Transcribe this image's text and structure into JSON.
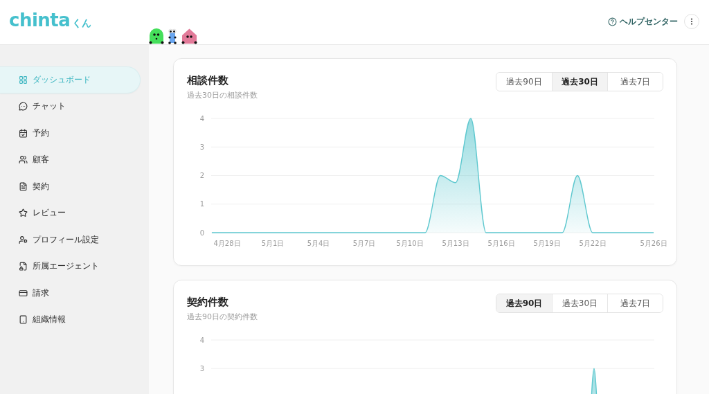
{
  "header": {
    "logo": {
      "wordmark": "chinta",
      "suffix": "くん"
    },
    "help_link": "ヘルプセンター"
  },
  "sidebar": {
    "items": [
      {
        "label": "ダッシュボード",
        "selected": true
      },
      {
        "label": "チャット",
        "selected": false
      },
      {
        "label": "予約",
        "selected": false
      },
      {
        "label": "顧客",
        "selected": false
      },
      {
        "label": "契約",
        "selected": false
      },
      {
        "label": "レビュー",
        "selected": false
      },
      {
        "label": "プロフィール設定",
        "selected": false
      },
      {
        "label": "所属エージェント",
        "selected": false
      },
      {
        "label": "請求",
        "selected": false
      },
      {
        "label": "組織情報",
        "selected": false
      }
    ]
  },
  "cards": [
    {
      "title": "相談件数",
      "subtitle": "過去30日の相談件数",
      "ranges": [
        {
          "label": "過去90日",
          "selected": false
        },
        {
          "label": "過去30日",
          "selected": true
        },
        {
          "label": "過去7日",
          "selected": false
        }
      ],
      "chart_data": {
        "type": "area",
        "grid": true,
        "categories": [
          null,
          "4月28日",
          null,
          null,
          "5月1日",
          null,
          null,
          "5月4日",
          null,
          null,
          "5月7日",
          null,
          null,
          "5月10日",
          null,
          null,
          "5月13日",
          null,
          null,
          "5月16日",
          null,
          null,
          "5月19日",
          null,
          null,
          "5月22日",
          null,
          null,
          null,
          "5月26日"
        ],
        "ylim": [
          0,
          4
        ],
        "yticks": [
          0,
          1,
          2,
          3,
          4
        ],
        "series": [
          {
            "color": "#5ec8cf",
            "values": [
              0,
              0,
              0,
              0,
              0,
              0,
              0,
              0,
              0,
              0,
              0,
              0,
              0,
              0,
              0,
              2,
              1.75,
              4,
              0,
              0,
              0,
              0,
              0,
              0,
              2,
              0,
              0,
              0,
              0,
              0
            ]
          }
        ]
      }
    },
    {
      "title": "契約件数",
      "subtitle": "過去90日の契約件数",
      "ranges": [
        {
          "label": "過去90日",
          "selected": true
        },
        {
          "label": "過去30日",
          "selected": false
        },
        {
          "label": "過去7日",
          "selected": false
        }
      ],
      "chart_data": {
        "type": "area",
        "grid": true,
        "categories": [
          null,
          null,
          null,
          null,
          null,
          null,
          null,
          null,
          null,
          null,
          null,
          null,
          null,
          null,
          null,
          null,
          null,
          null,
          null,
          null,
          null,
          null,
          null,
          null,
          null,
          null,
          null,
          null,
          null,
          null,
          null,
          null,
          null,
          null,
          null,
          null,
          null,
          null,
          null,
          null,
          null,
          null,
          null,
          null,
          null,
          null,
          null,
          null,
          null,
          null,
          null,
          null,
          null,
          null,
          null,
          null,
          null,
          null,
          null,
          null,
          null,
          null,
          null,
          null,
          null,
          null,
          null,
          null,
          null,
          null,
          null,
          null,
          null,
          null,
          null,
          null,
          null,
          null,
          null,
          null,
          null,
          null,
          null,
          null,
          null,
          null,
          null,
          null,
          null,
          null
        ],
        "ylim": [
          0,
          4
        ],
        "yticks": [
          3,
          4
        ],
        "series": [
          {
            "color": "#5ec8cf",
            "values": [
              null,
              null,
              null,
              null,
              null,
              null,
              null,
              null,
              null,
              null,
              null,
              null,
              null,
              null,
              null,
              null,
              null,
              null,
              null,
              null,
              null,
              null,
              null,
              null,
              null,
              null,
              null,
              null,
              null,
              null,
              null,
              null,
              null,
              null,
              null,
              null,
              null,
              null,
              null,
              null,
              null,
              null,
              null,
              null,
              null,
              null,
              null,
              null,
              null,
              null,
              null,
              null,
              null,
              null,
              null,
              null,
              null,
              null,
              null,
              null,
              null,
              null,
              null,
              null,
              null,
              null,
              null,
              null,
              null,
              null,
              null,
              null,
              null,
              null,
              null,
              null,
              0,
              3,
              0,
              null,
              null,
              null,
              null,
              null,
              null,
              null,
              null,
              null,
              null,
              null
            ]
          }
        ]
      }
    }
  ]
}
